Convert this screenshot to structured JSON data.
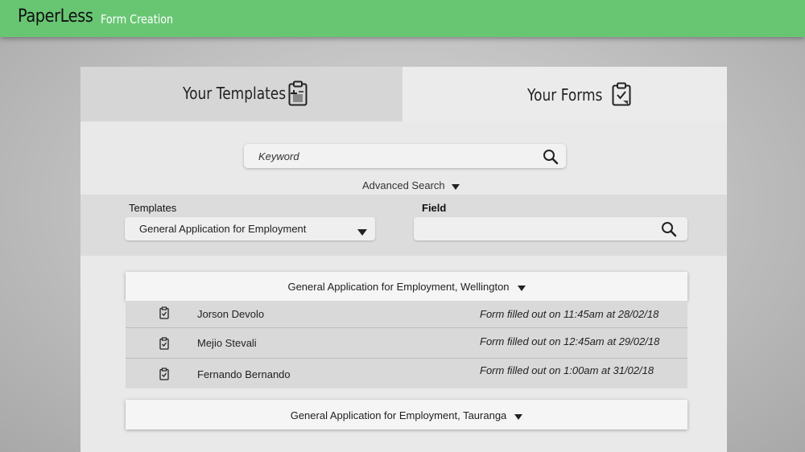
{
  "app": {
    "brand": "PaperLess",
    "section": "Form Creation"
  },
  "tabs": [
    {
      "label": "Your Templates",
      "icon": "clipboard-plus-icon",
      "active": false
    },
    {
      "label": "Your Forms",
      "icon": "clipboard-check-icon",
      "active": true
    }
  ],
  "search": {
    "placeholder": "Keyword",
    "value": "",
    "advanced_label": "Advanced Search"
  },
  "filters": {
    "templates_label": "Templates",
    "templates_selected": "General Application for Employment",
    "field_label": "Field",
    "field_value": ""
  },
  "groups": [
    {
      "title": "General Application for Employment, Wellington",
      "expanded": true,
      "entries": [
        {
          "name": "Jorson Devolo",
          "filled": "Form filled out on 11:45am at 28/02/18"
        },
        {
          "name": "Mejio Stevali",
          "filled": "Form filled out on 12:45am at 29/02/18"
        },
        {
          "name": "Fernando Bernando",
          "filled": "Form filled out on 1:00am at 31/02/18"
        }
      ]
    },
    {
      "title": "General Application for Employment, Tauranga",
      "expanded": false,
      "entries": []
    }
  ],
  "colors": {
    "topbar": "#68c673",
    "panel": "#e9e9e9",
    "inactive_tab": "#d6d6d6",
    "entry_row": "#d9d9d9"
  }
}
